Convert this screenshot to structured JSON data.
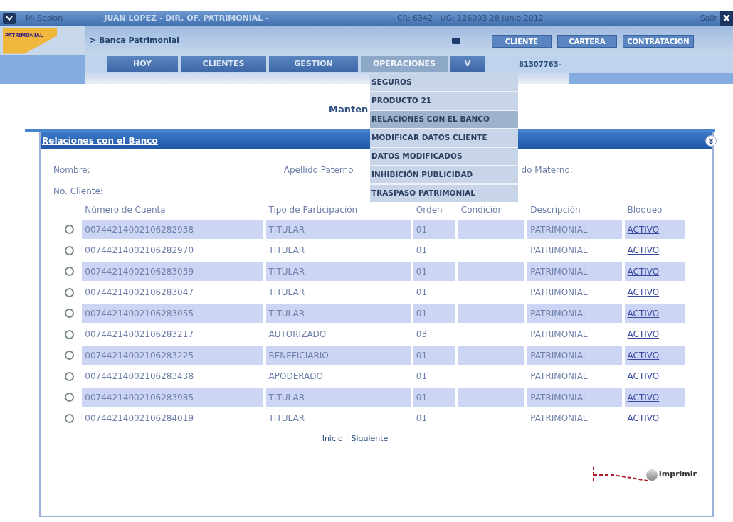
{
  "top_bar": {
    "session": "Mi Sesion",
    "user": "JUAN LOPEZ - DIR. OF. PATRIMONIAL -",
    "info": "CR: 6342   UG: 126003 28 junio 2012",
    "logout": "Salir",
    "close": "X"
  },
  "header": {
    "logo": "PATRIMONIAL",
    "breadcrumb": "> Banca Patrimonial",
    "buttons": [
      "CLIENTE",
      "CARTERA",
      "CONTRATACION"
    ]
  },
  "nav": {
    "tabs": [
      {
        "label": "HOY",
        "selected": false
      },
      {
        "label": "CLIENTES",
        "selected": false
      },
      {
        "label": "GESTION",
        "selected": false
      },
      {
        "label": "OPERACIONES",
        "selected": true
      },
      {
        "label": "V",
        "selected": false
      }
    ],
    "client_id": "81307763-"
  },
  "dropdown": {
    "items": [
      {
        "label": "SEGUROS",
        "selected": false
      },
      {
        "label": "PRODUCTO 21",
        "selected": false
      },
      {
        "label": "RELACIONES CON EL BANCO",
        "selected": true
      },
      {
        "label": "MODIFICAR DATOS CLIENTE",
        "selected": false
      },
      {
        "label": "DATOS MODIFICADOS",
        "selected": false
      },
      {
        "label": "INHIBICIÓN PUBLICIDAD",
        "selected": false
      },
      {
        "label": "TRASPASO PATRIMONIAL",
        "selected": false
      }
    ]
  },
  "page_title": "Manten",
  "panel": {
    "title": "Relaciones con el Banco",
    "fields": {
      "nombre": "Nombre:",
      "apellido_paterno": "Apellido Paterno",
      "apellido_materno": "do Materno:",
      "no_cliente": "No. Cliente:"
    },
    "table": {
      "columns": [
        "Número de Cuenta",
        "Tipo de Participación",
        "Orden",
        "Condición",
        "Descripción",
        "Bloqueo"
      ],
      "rows": [
        {
          "selected": false,
          "cells": [
            "00744214002106282938",
            "TITULAR",
            "01",
            "",
            "PATRIMONIAL",
            "ACTIVO"
          ]
        },
        {
          "selected": false,
          "cells": [
            "00744214002106282970",
            "TITULAR",
            "01",
            "",
            "PATRIMONIAL",
            "ACTIVO"
          ]
        },
        {
          "selected": false,
          "cells": [
            "00744214002106283039",
            "TITULAR",
            "01",
            "",
            "PATRIMONIAL",
            "ACTIVO"
          ]
        },
        {
          "selected": false,
          "cells": [
            "00744214002106283047",
            "TITULAR",
            "01",
            "",
            "PATRIMONIAL",
            "ACTIVO"
          ]
        },
        {
          "selected": false,
          "cells": [
            "00744214002106283055",
            "TITULAR",
            "01",
            "",
            "PATRIMONIAL",
            "ACTIVO"
          ]
        },
        {
          "selected": false,
          "cells": [
            "00744214002106283217",
            "AUTORIZADO",
            "03",
            "",
            "PATRIMONIAL",
            "ACTIVO"
          ]
        },
        {
          "selected": false,
          "cells": [
            "00744214002106283225",
            "BENEFICIARIO",
            "01",
            "",
            "PATRIMONIAL",
            "ACTIVO"
          ]
        },
        {
          "selected": false,
          "cells": [
            "00744214002106283438",
            "APODERADO",
            "01",
            "",
            "PATRIMONIAL",
            "ACTIVO"
          ]
        },
        {
          "selected": false,
          "cells": [
            "00744214002106283985",
            "TITULAR",
            "01",
            "",
            "PATRIMONIAL",
            "ACTIVO"
          ]
        },
        {
          "selected": false,
          "cells": [
            "00744214002106284019",
            "TITULAR",
            "01",
            "",
            "PATRIMONIAL",
            "ACTIVO"
          ]
        }
      ]
    },
    "pager": {
      "first": "Inicio",
      "separator": "|",
      "next": "Siguiente"
    },
    "print": "Imprimir"
  }
}
